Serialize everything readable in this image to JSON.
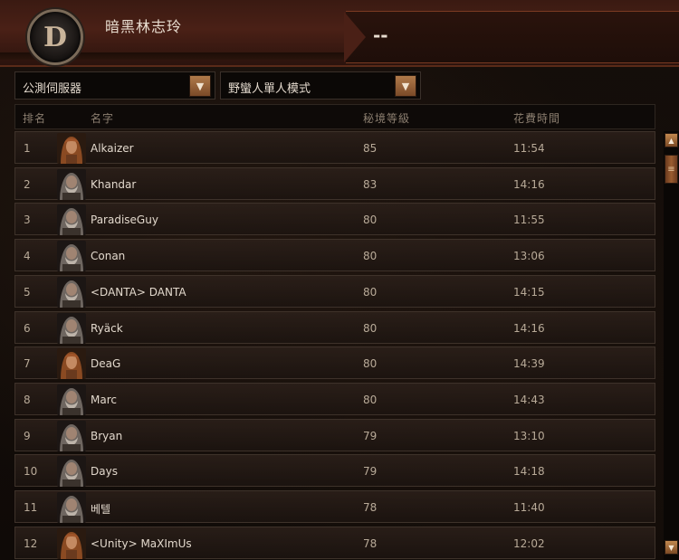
{
  "header": {
    "title": "暗黑林志玲",
    "status": "--",
    "emblem_letter": "D"
  },
  "filters": {
    "server": "公測伺服器",
    "mode": "野蠻人單人模式"
  },
  "table": {
    "columns": [
      "排名",
      "名字",
      "秘境等級",
      "花費時間"
    ],
    "rows": [
      {
        "rank": "1",
        "name": "Alkaizer",
        "level": "85",
        "time": "11:54",
        "portrait": "female-barbarian"
      },
      {
        "rank": "2",
        "name": "Khandar",
        "level": "83",
        "time": "14:16",
        "portrait": "male-barbarian"
      },
      {
        "rank": "3",
        "name": "ParadiseGuy",
        "level": "80",
        "time": "11:55",
        "portrait": "male-barbarian"
      },
      {
        "rank": "4",
        "name": "Conan",
        "level": "80",
        "time": "13:06",
        "portrait": "male-barbarian"
      },
      {
        "rank": "5",
        "name": "<DANTA> DANTA",
        "level": "80",
        "time": "14:15",
        "portrait": "male-barbarian"
      },
      {
        "rank": "6",
        "name": "Ryäck",
        "level": "80",
        "time": "14:16",
        "portrait": "male-barbarian"
      },
      {
        "rank": "7",
        "name": "DeaG",
        "level": "80",
        "time": "14:39",
        "portrait": "female-barbarian"
      },
      {
        "rank": "8",
        "name": "Marc",
        "level": "80",
        "time": "14:43",
        "portrait": "male-barbarian"
      },
      {
        "rank": "9",
        "name": "Bryan",
        "level": "79",
        "time": "13:10",
        "portrait": "male-barbarian"
      },
      {
        "rank": "10",
        "name": "Days",
        "level": "79",
        "time": "14:18",
        "portrait": "male-barbarian"
      },
      {
        "rank": "11",
        "name": "베텔",
        "level": "78",
        "time": "11:40",
        "portrait": "male-barbarian"
      },
      {
        "rank": "12",
        "name": "<Unity> MaXImUs",
        "level": "78",
        "time": "12:02",
        "portrait": "female-barbarian"
      }
    ]
  },
  "colors": {
    "accent": "#b07a4a",
    "header_red": "#4a2016",
    "text": "#e2d8cc"
  }
}
